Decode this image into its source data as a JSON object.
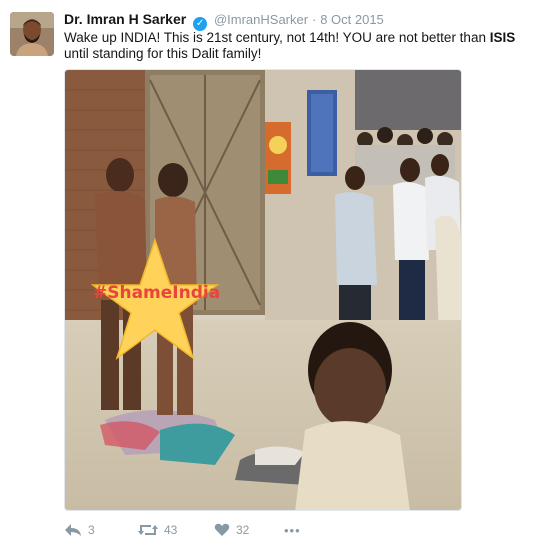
{
  "tweet": {
    "author_name": "Dr. Imran H Sarker",
    "handle": "@ImranHSarker",
    "separator": "·",
    "date": "8 Oct 2015",
    "text_part1": "Wake up INDIA! This is 21st century, not 14th! YOU are not better than ",
    "text_bold": "ISIS",
    "text_part2": " until standing for this Dalit family!"
  },
  "media": {
    "hashtag_overlay": "#ShameIndia",
    "icon": "photo"
  },
  "actions": {
    "reply_count": "3",
    "retweet_count": "43",
    "like_count": "32",
    "more_label": "•••"
  },
  "icons": {
    "verified": "verified-badge-icon",
    "reply": "reply-icon",
    "retweet": "retweet-icon",
    "like": "heart-icon",
    "more": "more-icon"
  },
  "colors": {
    "verified": "#1da1f2",
    "meta_text": "#8899a6",
    "star": "#ffd25a",
    "hashtag": "#e8453c"
  }
}
